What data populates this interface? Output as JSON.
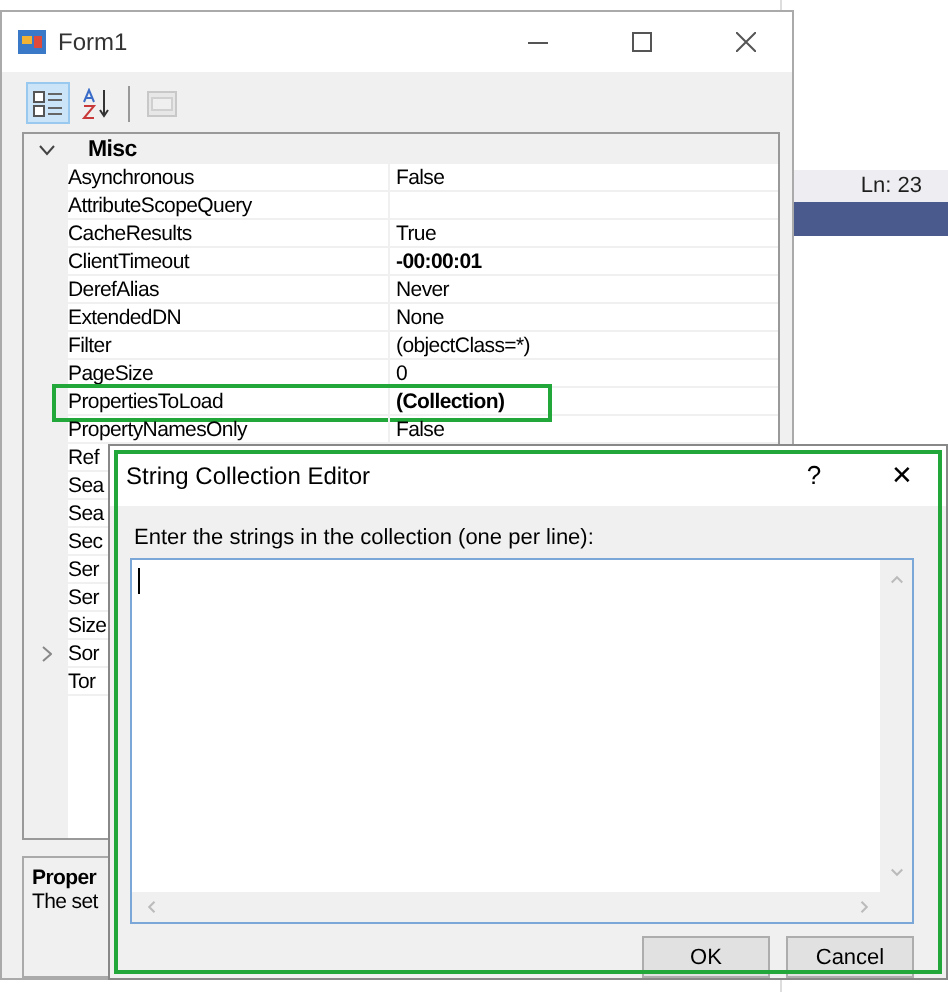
{
  "background_app": {
    "status": "Ln: 23"
  },
  "form": {
    "title": "Form1",
    "toolbar": [
      {
        "kind": "categorized",
        "selected": true
      },
      {
        "kind": "alphabetical",
        "selected": false
      },
      {
        "kind": "pages",
        "disabled": true
      }
    ],
    "grid": {
      "category": {
        "name": "Misc",
        "expanded": true
      },
      "properties": [
        {
          "name": "Asynchronous",
          "value": "False",
          "modified": false
        },
        {
          "name": "AttributeScopeQuery"
        },
        {
          "name": "CacheResults",
          "value": "True",
          "modified": false
        },
        {
          "name": "ClientTimeout",
          "value": "-00:00:01",
          "modified": true
        },
        {
          "name": "DerefAlias",
          "value": "Never",
          "modified": false
        },
        {
          "name": "ExtendedDN",
          "value": "None",
          "modified": false
        },
        {
          "name": "Filter",
          "value": "(objectClass=*)",
          "modified": false
        },
        {
          "name": "PageSize",
          "value": "0",
          "modified": false
        },
        {
          "name": "PropertiesToLoad",
          "value": "(Collection)",
          "modified": true,
          "highlighted": true
        },
        {
          "name": "PropertyNamesOnly",
          "value": "False",
          "modified": false
        },
        {
          "name": "Ref"
        },
        {
          "name": "Sea"
        },
        {
          "name": "Sea"
        },
        {
          "name": "Sec"
        },
        {
          "name": "Ser"
        },
        {
          "name": "Ser"
        },
        {
          "name": "Size"
        },
        {
          "name": "Sor",
          "expandable": true
        },
        {
          "name": "Tor"
        }
      ]
    },
    "description": {
      "title": "Proper",
      "text": "The set"
    }
  },
  "dialog": {
    "title": "String Collection Editor",
    "help": "?",
    "close": "✕",
    "highlighted": true,
    "label": "Enter the strings in the collection (one per line):",
    "buttons": [
      "OK",
      "Cancel"
    ]
  }
}
